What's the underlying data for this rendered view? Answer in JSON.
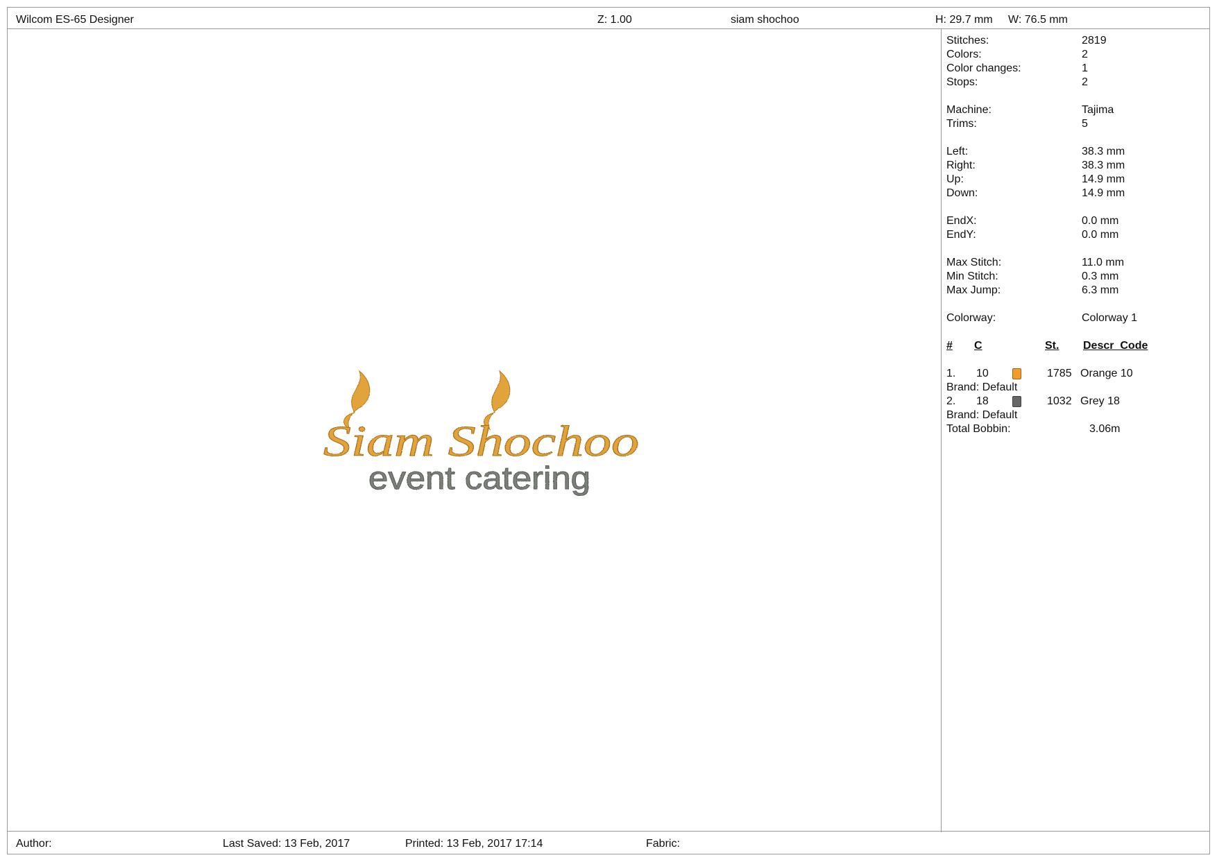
{
  "header": {
    "app_name": "Wilcom ES-65 Designer",
    "zoom": "Z: 1.00",
    "design_name": "siam shochoo",
    "height": "H: 29.7 mm",
    "width": "W: 76.5 mm"
  },
  "design": {
    "line1": "Siam Shochoo",
    "line2": "event catering",
    "colors": {
      "orange": "#e3a33a",
      "grey": "#7b7f7a"
    }
  },
  "stats": {
    "stitches_label": "Stitches:",
    "stitches": "2819",
    "colors_label": "Colors:",
    "colors": "2",
    "color_changes_label": "Color changes:",
    "color_changes": "1",
    "stops_label": "Stops:",
    "stops": "2",
    "machine_label": "Machine:",
    "machine": "Tajima",
    "trims_label": "Trims:",
    "trims": "5",
    "left_label": "Left:",
    "left": "38.3 mm",
    "right_label": "Right:",
    "right": "38.3 mm",
    "up_label": "Up:",
    "up": "14.9 mm",
    "down_label": "Down:",
    "down": "14.9 mm",
    "endx_label": "EndX:",
    "endx": "0.0 mm",
    "endy_label": "EndY:",
    "endy": "0.0 mm",
    "max_stitch_label": "Max Stitch:",
    "max_stitch": "11.0 mm",
    "min_stitch_label": "Min Stitch:",
    "min_stitch": "0.3 mm",
    "max_jump_label": "Max Jump:",
    "max_jump": "6.3 mm",
    "colorway_label": "Colorway:",
    "colorway": "Colorway 1"
  },
  "color_table": {
    "headers": {
      "num": "#",
      "code": "C",
      "stitches": "St.",
      "desc": "Descr  Code"
    },
    "rows": [
      {
        "num": "1.",
        "code": "10",
        "swatch": "#f39b2c",
        "stitches": "1785",
        "desc": "Orange 10",
        "brand": "Brand: Default"
      },
      {
        "num": "2.",
        "code": "18",
        "swatch": "#666666",
        "stitches": "1032",
        "desc": "Grey 18",
        "brand": "Brand: Default"
      }
    ],
    "total_bobbin_label": "Total Bobbin:",
    "total_bobbin": "3.06m"
  },
  "footer": {
    "author": "Author:",
    "last_saved": "Last Saved: 13 Feb, 2017",
    "printed": "Printed: 13 Feb, 2017 17:14",
    "fabric": "Fabric:"
  }
}
